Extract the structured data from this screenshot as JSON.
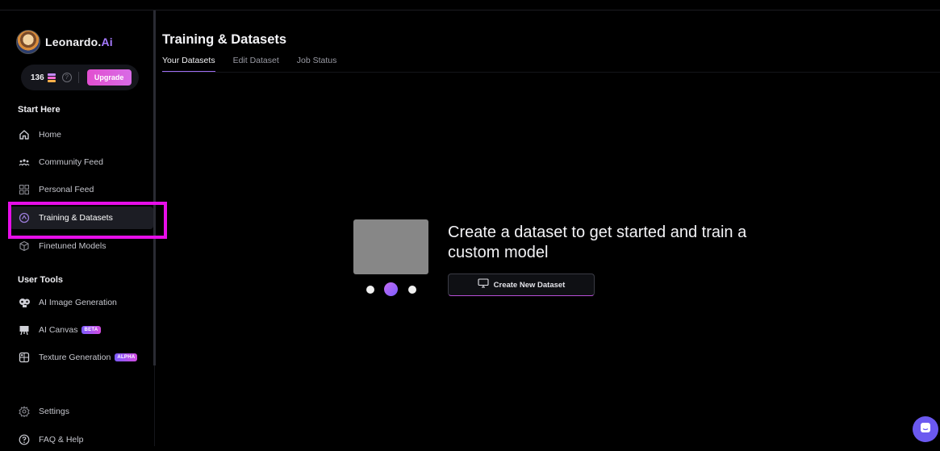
{
  "brand": {
    "name": "Leonardo.",
    "accent": "Ai"
  },
  "credits": {
    "count": "136",
    "upgrade_label": "Upgrade"
  },
  "sidebar": {
    "section_start": "Start Here",
    "start_items": [
      {
        "label": "Home",
        "icon": "home-icon"
      },
      {
        "label": "Community Feed",
        "icon": "community-icon"
      },
      {
        "label": "Personal Feed",
        "icon": "grid-icon"
      },
      {
        "label": "Training & Datasets",
        "icon": "training-icon",
        "active": true
      },
      {
        "label": "Finetuned Models",
        "icon": "cube-icon"
      }
    ],
    "section_tools": "User Tools",
    "tool_items": [
      {
        "label": "AI Image Generation",
        "icon": "image-generation-icon"
      },
      {
        "label": "AI Canvas",
        "icon": "canvas-icon",
        "badge": "BETA"
      },
      {
        "label": "Texture Generation",
        "icon": "texture-icon",
        "badge": "ALPHA"
      }
    ],
    "bottom_items": [
      {
        "label": "Settings",
        "icon": "gear-icon"
      },
      {
        "label": "FAQ & Help",
        "icon": "help-icon"
      }
    ]
  },
  "main": {
    "title": "Training & Datasets",
    "tabs": [
      {
        "label": "Your Datasets",
        "active": true
      },
      {
        "label": "Edit Dataset"
      },
      {
        "label": "Job Status"
      }
    ],
    "empty_state": {
      "headline": "Create a dataset to get started and train a custom model",
      "button_label": "Create New Dataset"
    }
  },
  "colors": {
    "background": "#000000",
    "accent_purple": "#9e6cf2",
    "upgrade_pink": "#e24fd0",
    "highlight_magenta": "#e70ee9",
    "chat_bubble": "#6b59f0"
  }
}
